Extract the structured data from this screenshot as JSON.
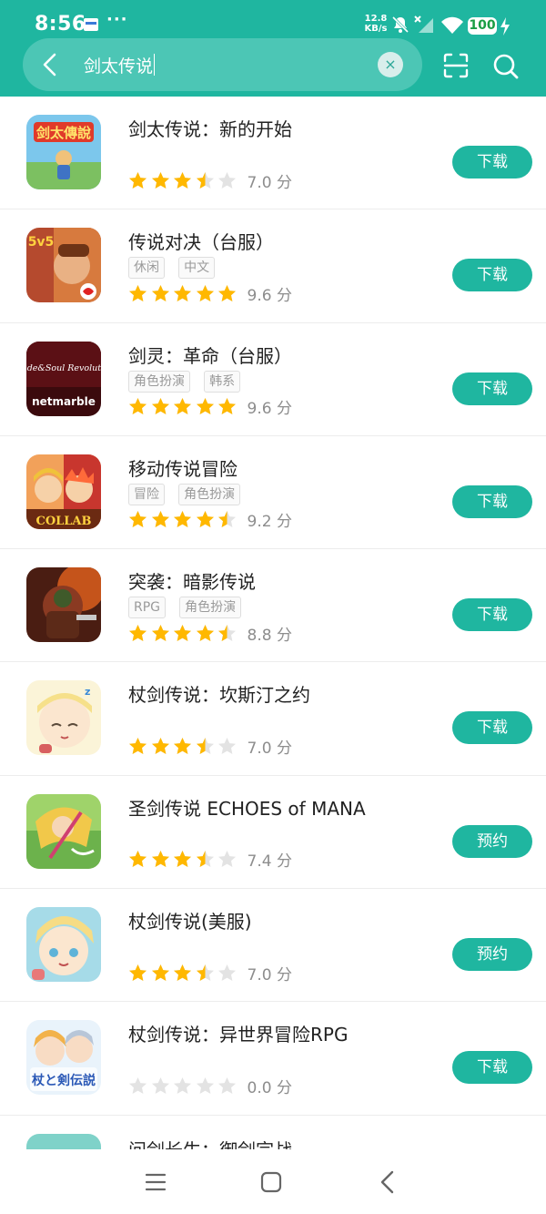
{
  "status_bar": {
    "time": "8:56",
    "more": "···",
    "net_speed_value": "12.8",
    "net_speed_unit": "KB/s",
    "battery": "100"
  },
  "search": {
    "query": "剑太传说",
    "clear_label": "×"
  },
  "apps": [
    {
      "title": "剑太传说：新的开始",
      "tags": [],
      "rating": 3.5,
      "score": "7.0 分",
      "action": "下载"
    },
    {
      "title": "传说对决（台服）",
      "tags": [
        "休闲",
        "中文"
      ],
      "rating": 5,
      "score": "9.6 分",
      "action": "下载"
    },
    {
      "title": "剑灵：革命（台服）",
      "tags": [
        "角色扮演",
        "韩系"
      ],
      "rating": 5,
      "score": "9.6 分",
      "action": "下载"
    },
    {
      "title": "移动传说冒险",
      "tags": [
        "冒险",
        "角色扮演"
      ],
      "rating": 4.5,
      "score": "9.2 分",
      "action": "下载"
    },
    {
      "title": "突袭：暗影传说",
      "tags": [
        "RPG",
        "角色扮演"
      ],
      "rating": 4.5,
      "score": "8.8 分",
      "action": "下载"
    },
    {
      "title": "杖剑传说：坎斯汀之约",
      "tags": [],
      "rating": 3.5,
      "score": "7.0 分",
      "action": "下载"
    },
    {
      "title": "圣剑传说 ECHOES of MANA",
      "tags": [],
      "rating": 3.5,
      "score": "7.4 分",
      "action": "预约"
    },
    {
      "title": "杖剑传说(美服)",
      "tags": [],
      "rating": 3.5,
      "score": "7.0 分",
      "action": "预约"
    },
    {
      "title": "杖剑传说：异世界冒险RPG",
      "tags": [],
      "rating": 0,
      "score": "0.0 分",
      "action": "下载"
    },
    {
      "title": "问剑长生：御剑宗战",
      "tags": [],
      "rating": null,
      "score": "",
      "action": ""
    }
  ],
  "icons": {
    "app_icon_labels": [
      "剑太傳說",
      "5v5",
      "Blade&Soul Revolution",
      "COLLAB",
      "",
      "",
      "",
      "",
      "杖と剣伝説",
      ""
    ],
    "brand_sub": "netmarble"
  },
  "colors": {
    "brand": "#1fb6a0",
    "star_on": "#ffb800",
    "star_off": "#e3e3e3"
  }
}
